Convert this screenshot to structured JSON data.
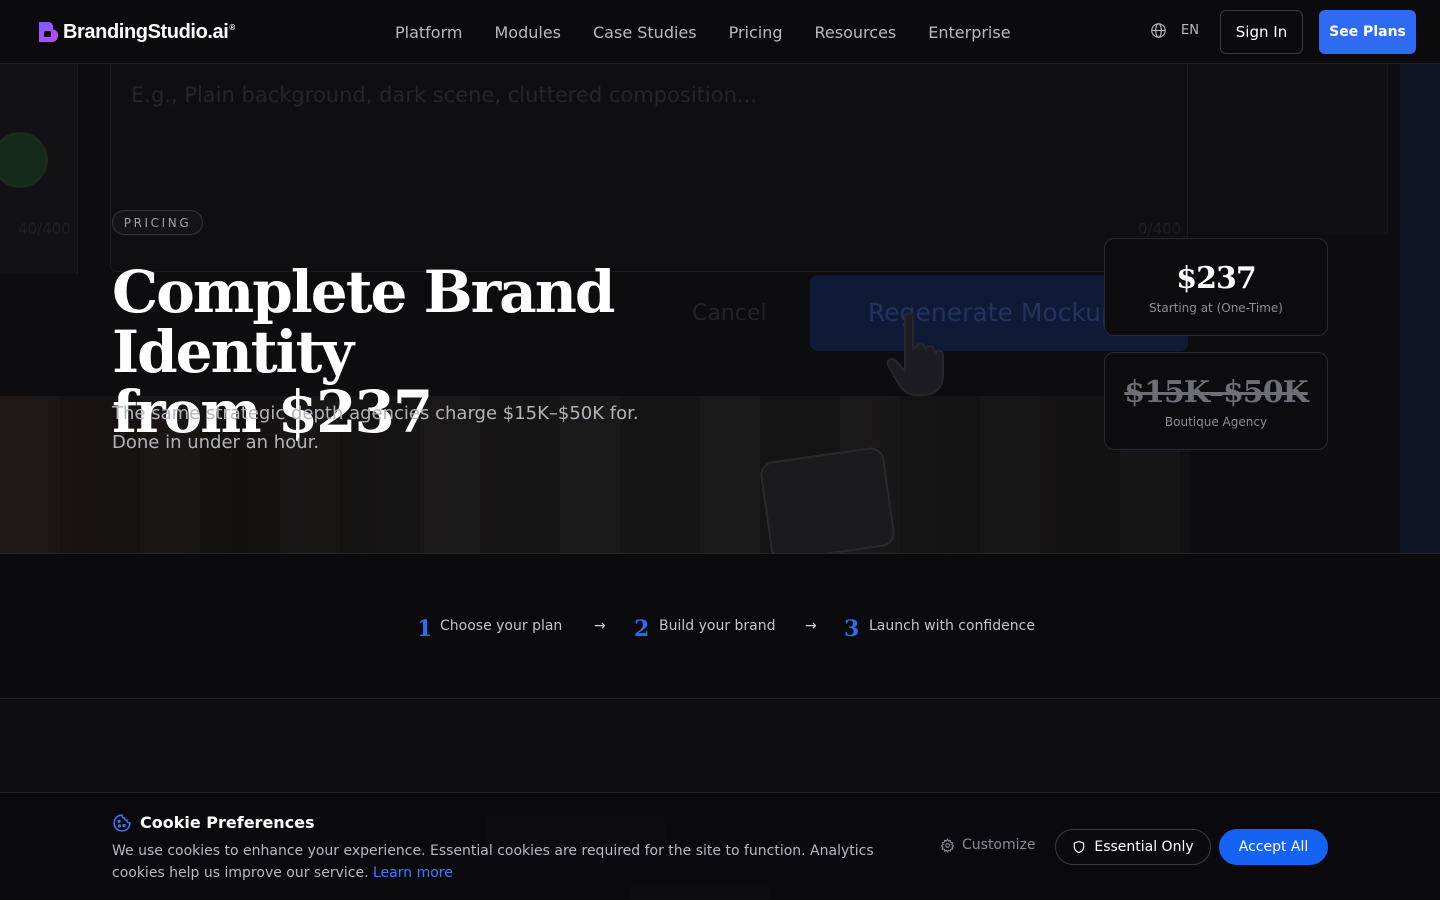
{
  "brand": {
    "name": "BrandingStudio.ai",
    "mark": "®",
    "accent_color": "#2f6bf2"
  },
  "nav": {
    "links": [
      "Platform",
      "Modules",
      "Case Studies",
      "Pricing",
      "Resources",
      "Enterprise"
    ],
    "language": "EN",
    "sign_in": "Sign In",
    "see_plans": "See Plans"
  },
  "background": {
    "placeholder": "E.g., Plain background, dark scene, cluttered composition...",
    "count_left": "40/400",
    "count_right": "0/400",
    "cancel": "Cancel",
    "regenerate": "Regenerate Mockup"
  },
  "hero": {
    "eyebrow": "PRICING",
    "title_line1": "Complete Brand Identity",
    "title_line2": "from $237",
    "subtitle_line1": "The same strategic depth agencies charge $15K–$50K for.",
    "subtitle_line2": "Done in under an hour."
  },
  "price_cards": [
    {
      "amount": "$237",
      "label": "Starting at (One-Time)"
    },
    {
      "amount": "$15K–$50K",
      "label": "Boutique Agency"
    }
  ],
  "steps": [
    {
      "num": "1",
      "label": "Choose your plan"
    },
    {
      "num": "2",
      "label": "Build your brand"
    },
    {
      "num": "3",
      "label": "Launch with confidence"
    }
  ],
  "step_arrow": "→",
  "cookie": {
    "title": "Cookie Preferences",
    "text": "We use cookies to enhance your experience. Essential cookies are required for the site to function. Analytics cookies help us improve our service.",
    "learn_more": "Learn more",
    "customize": "Customize",
    "essential_only": "Essential Only",
    "accept_all": "Accept All"
  }
}
